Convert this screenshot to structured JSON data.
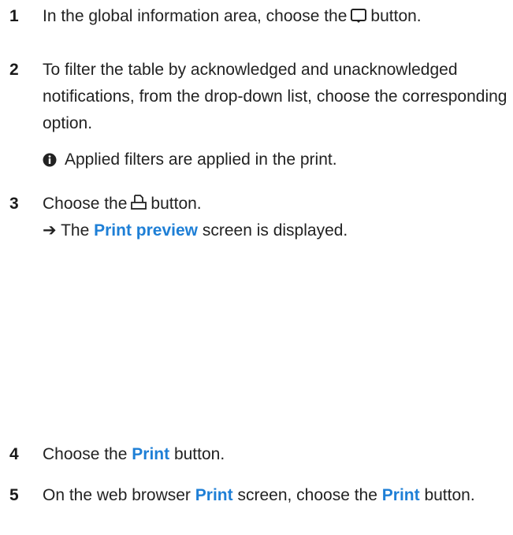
{
  "steps": [
    {
      "number": "1",
      "text_before": "In the global information area, choose the",
      "icon": "notifications-icon",
      "text_after": "button."
    },
    {
      "number": "2",
      "text": "To filter the table by acknowledged and unacknowledged notifications, from the drop-down list, choose the corresponding option.",
      "note_icon": "info-icon",
      "note": "Applied filters are applied in the print."
    },
    {
      "number": "3",
      "text_before": "Choose the",
      "icon": "print-icon",
      "text_after": "button.",
      "result_arrow": "➔",
      "result_before": "The",
      "result_highlight": "Print preview",
      "result_after": "screen is displayed."
    },
    {
      "number": "4",
      "text_before": "Choose the",
      "highlight": "Print",
      "text_after": "button."
    },
    {
      "number": "5",
      "text_before": "On the web browser",
      "highlight1": "Print",
      "text_middle": "screen, choose the",
      "highlight2": "Print",
      "text_after": "button."
    }
  ],
  "colors": {
    "highlight": "#1e7fd6",
    "text": "#222222"
  }
}
